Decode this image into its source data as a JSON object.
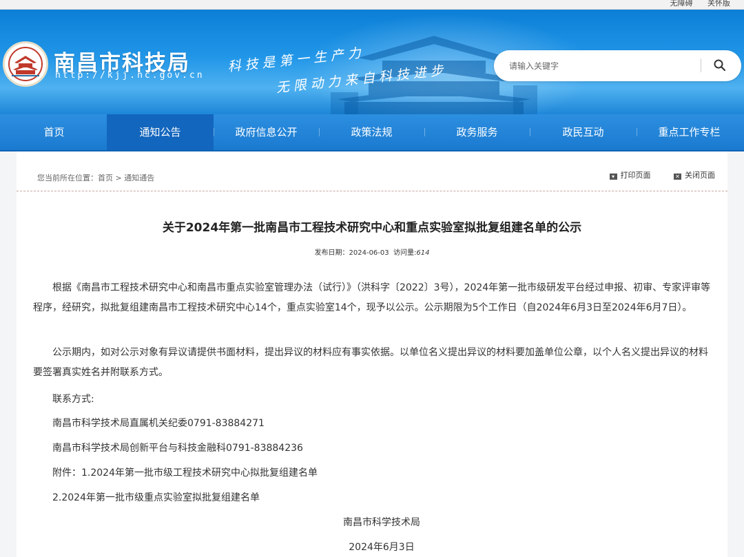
{
  "topbar": {
    "link1": "无障碍",
    "link2": "关怀版"
  },
  "header": {
    "site_name": "南昌市科技局",
    "site_url": "http://kjj.nc.gov.cn",
    "slogan_line1": "科技是第一生产力",
    "slogan_line2": "无限动力来自科技进步",
    "search_placeholder": "请输入关键字"
  },
  "nav": {
    "items": [
      {
        "label": "首页"
      },
      {
        "label": "通知公告"
      },
      {
        "label": "政府信息公开"
      },
      {
        "label": "政策法规"
      },
      {
        "label": "政务服务"
      },
      {
        "label": "政民互动"
      },
      {
        "label": "重点工作专栏"
      }
    ],
    "active_index": 1
  },
  "breadcrumb": {
    "prefix": "您当前所在位置：",
    "home": "首页",
    "sep": " > ",
    "current": "通知通告"
  },
  "tools": {
    "print": "打印页面",
    "close": "关闭页面"
  },
  "article": {
    "title": "关于2024年第一批南昌市工程技术研究中心和重点实验室拟批复组建名单的公示",
    "date_label": "发布日期：",
    "date": "2024-06-03",
    "views_label": "访问量:",
    "views": "614",
    "para1": "根据《南昌市工程技术研究中心和南昌市重点实验室管理办法（试行）》（洪科字〔2022〕3号），2024年第一批市级研发平台经过申报、初审、专家评审等程序，经研究，拟批复组建南昌市工程技术研究中心14个，重点实验室14个，现予以公示。公示期限为5个工作日（自2024年6月3日至2024年6月7日）。",
    "para2": "公示期内，如对公示对象有异议请提供书面材料，提出异议的材料应有事实依据。以单位名义提出异议的材料要加盖单位公章，以个人名义提出异议的材料要签署真实姓名并附联系方式。",
    "contact_label": "联系方式:",
    "contact1": "南昌市科学技术局直属机关纪委0791-83884271",
    "contact2": "南昌市科学技术局创新平台与科技金融科0791-83884236",
    "attachment1": "附件：1.2024年第一批市级工程技术研究中心拟批复组建名单",
    "attachment2": "2.2024年第一批市级重点实验室拟批复组建名单",
    "signature": "南昌市科学技术局",
    "sign_date": "2024年6月3日"
  },
  "colors": {
    "nav_bg": "#1a7ad0",
    "nav_active": "#1366bd",
    "banner_blue": "#2196e8"
  }
}
